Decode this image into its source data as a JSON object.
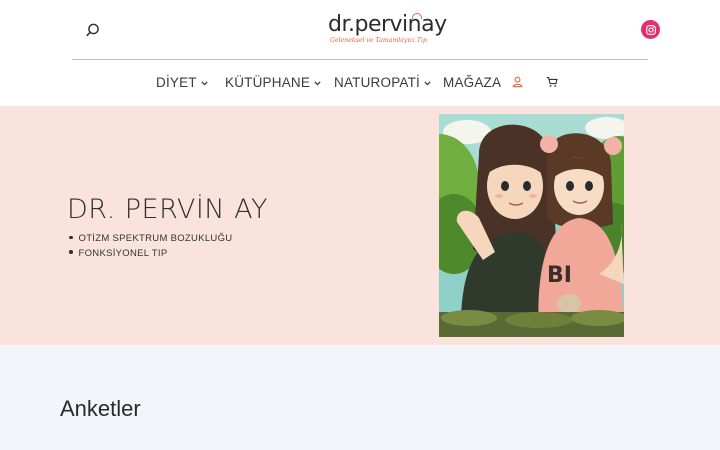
{
  "header": {
    "logo_text": "dr.pervinay",
    "logo_tagline": "Geleneksel ve Tamamlayıcı Tıp",
    "search_icon": "search-icon",
    "social_icon": "instagram-icon",
    "social_color": "#e1306c"
  },
  "nav": {
    "items": [
      {
        "label": "DİYET",
        "has_dropdown": true
      },
      {
        "label": "KÜTÜPHANE",
        "has_dropdown": true
      },
      {
        "label": "NATUROPATİ",
        "has_dropdown": true
      },
      {
        "label": "MAĞAZA",
        "has_dropdown": false
      }
    ],
    "account_icon": "user-icon",
    "cart_icon": "cart-icon",
    "account_icon_color": "#e0734a"
  },
  "hero": {
    "title": "DR. PERVİN AY",
    "bullets": [
      "OTİZM SPEKTRUM BOZUKLUĞU",
      "FONKSİYONEL TIP"
    ],
    "background": "#f9e3dc",
    "image_alt": "Anime-style illustration of a woman and a young girl embracing outdoors"
  },
  "section": {
    "title": "Anketler",
    "background": "#f2f5fa"
  }
}
